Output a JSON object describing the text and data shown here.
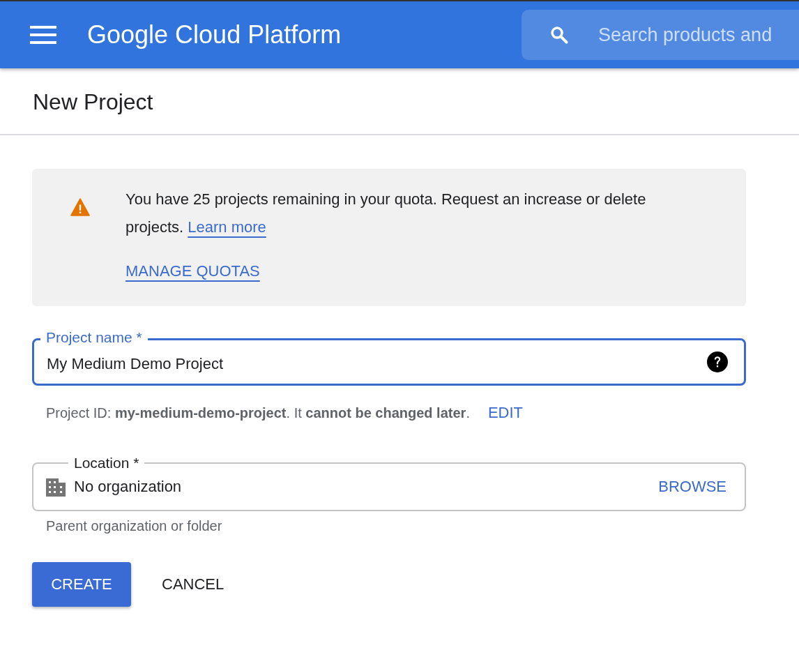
{
  "header": {
    "title": "Google Cloud Platform",
    "search": {
      "placeholder": "Search products and"
    }
  },
  "page_title": "New Project",
  "notice": {
    "text": "You have 25 projects remaining in your quota. Request an increase or delete projects.",
    "link": "Learn more",
    "action": "MANAGE QUOTAS"
  },
  "project_name": {
    "label": "Project name *",
    "value": "My Medium Demo Project",
    "focused": true
  },
  "project_id_hint": {
    "text": "Project ID: **my-medium-demo-project**. It **cannot be changed later**.",
    "action": "EDIT"
  },
  "location": {
    "label": "Location *",
    "value": "No organization",
    "action": "BROWSE",
    "hint": "Parent organization or folder"
  },
  "buttons": [
    {
      "label": "CREATE",
      "kind": "primary"
    },
    {
      "label": "CANCEL",
      "kind": "text"
    }
  ]
}
